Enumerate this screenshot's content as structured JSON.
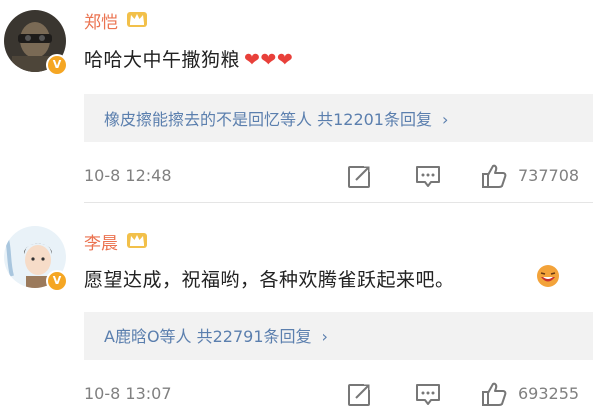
{
  "comments": [
    {
      "name": "郑恺",
      "content": "哈哈大中午撒狗粮",
      "reply_summary": "橡皮擦能擦去的不是回忆等人  共12201条回复",
      "time": "10-8 12:48",
      "likes": "737708"
    },
    {
      "name": "李晨",
      "content": "愿望达成，祝福哟，各种欢腾雀跃起来吧。",
      "reply_summary": "A鹿晗O等人  共22791条回复",
      "time": "10-8 13:07",
      "likes": "693255"
    }
  ],
  "icons": {
    "verified": "verified-badge-icon",
    "crown": "crown-member-icon",
    "heart": "heart-emoji-icon",
    "edit": "forward-icon",
    "comment": "comment-icon",
    "like": "like-thumb-icon",
    "chevron": "chevron-right-icon"
  },
  "colors": {
    "name": "#eb7350",
    "link": "#5b7fae",
    "heart": "#e8403a",
    "badge": "#f5a623"
  }
}
